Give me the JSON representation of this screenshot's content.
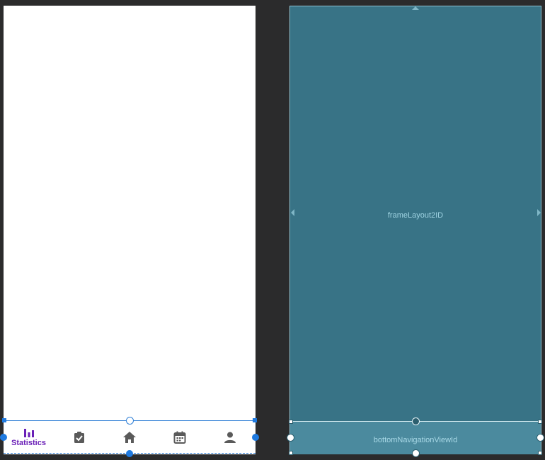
{
  "design": {
    "nav_items": [
      {
        "label": "Statistics",
        "icon": "bar-chart-icon",
        "selected": true
      },
      {
        "label": "",
        "icon": "task-check-icon",
        "selected": false
      },
      {
        "label": "",
        "icon": "home-icon",
        "selected": false
      },
      {
        "label": "",
        "icon": "calendar-icon",
        "selected": false
      },
      {
        "label": "",
        "icon": "person-icon",
        "selected": false
      }
    ],
    "accent_color": "#6a1fb7",
    "selection_color": "#2f7fd6"
  },
  "blueprint": {
    "frame_label": "frameLayout2ID",
    "nav_label": "bottomNavigationViewId",
    "background": "#387386"
  }
}
